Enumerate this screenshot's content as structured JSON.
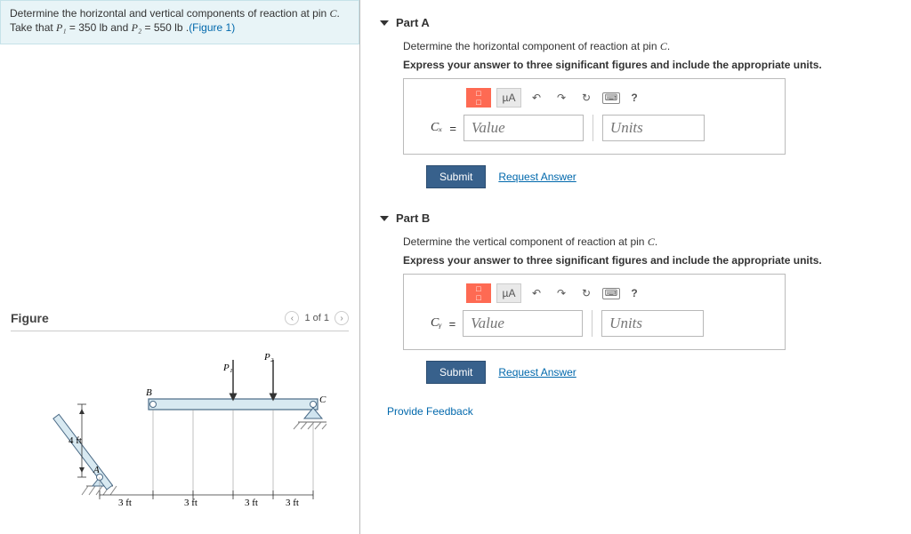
{
  "prompt": {
    "line": "Determine the horizontal and vertical components of reaction at pin ",
    "pin": "C",
    "tail": ".",
    "take": "Take that ",
    "p1_l": "P₁",
    "p1_v": " = 350 lb",
    "and": " and ",
    "p2_l": "P₂",
    "p2_v": " = 550 lb .",
    "fig_link": "(Figure 1)"
  },
  "figure": {
    "title": "Figure",
    "pager": "1 of 1",
    "labels": {
      "A": "A",
      "B": "B",
      "C": "C",
      "P1": "P₁",
      "P2": "P₂",
      "h": "4 ft",
      "d1": "3 ft",
      "d2": "3 ft",
      "d3": "3 ft",
      "d4": "3 ft"
    }
  },
  "partA": {
    "title": "Part A",
    "prompt": "Determine the horizontal component of reaction at pin ",
    "pin": "C",
    "tail": ".",
    "instr": "Express your answer to three significant figures and include the appropriate units.",
    "toolbar": {
      "symb": "µA",
      "q": "?"
    },
    "var": "Cₓ",
    "eq": "=",
    "val_ph": "Value",
    "unit_ph": "Units",
    "submit": "Submit",
    "request": "Request Answer"
  },
  "partB": {
    "title": "Part B",
    "prompt": "Determine the vertical component of reaction at pin ",
    "pin": "C",
    "tail": ".",
    "instr": "Express your answer to three significant figures and include the appropriate units.",
    "toolbar": {
      "symb": "µA",
      "q": "?"
    },
    "var": "Cᵧ",
    "eq": "=",
    "val_ph": "Value",
    "unit_ph": "Units",
    "submit": "Submit",
    "request": "Request Answer"
  },
  "feedback": "Provide Feedback"
}
